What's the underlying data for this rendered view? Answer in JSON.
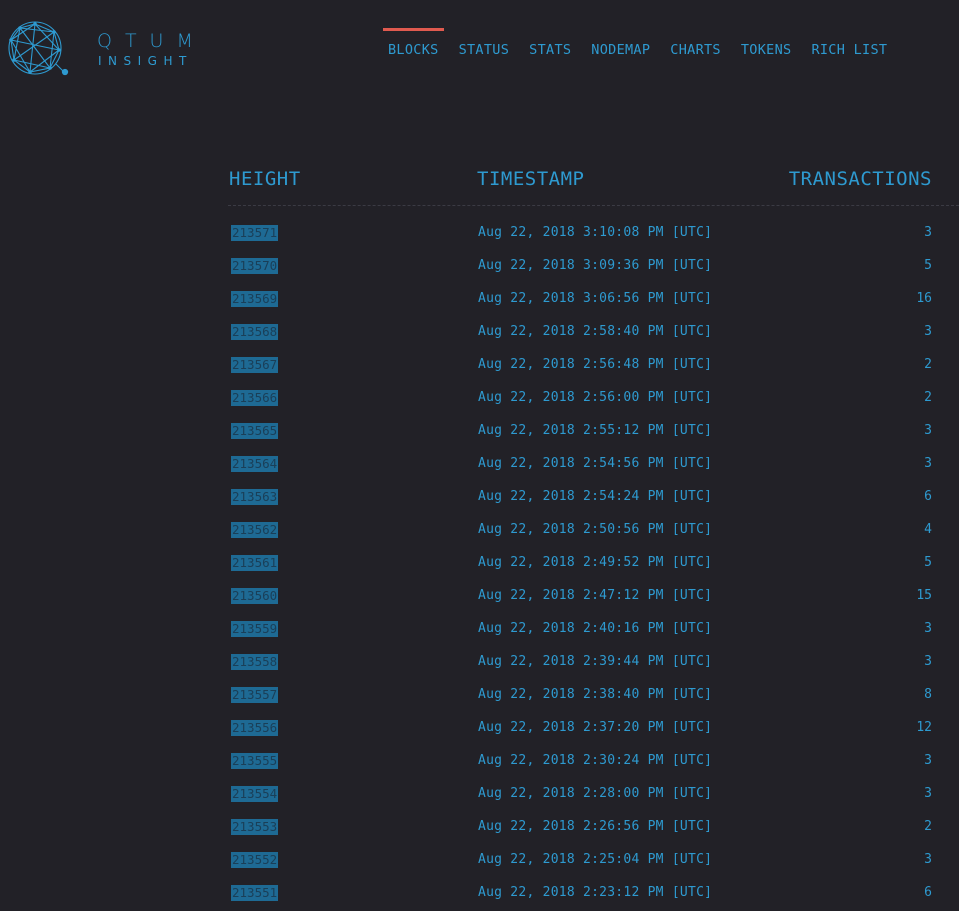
{
  "brand": {
    "name": "QTUM",
    "subtitle": "INSIGHT",
    "logo_icon": "qtum-network-icon",
    "accent_color": "#2e9ad0",
    "active_color": "#e05a4f"
  },
  "nav": {
    "items": [
      {
        "label": "BLOCKS",
        "active": true
      },
      {
        "label": "STATUS",
        "active": false
      },
      {
        "label": "STATS",
        "active": false
      },
      {
        "label": "NODEMAP",
        "active": false
      },
      {
        "label": "CHARTS",
        "active": false
      },
      {
        "label": "TOKENS",
        "active": false
      },
      {
        "label": "RICH LIST",
        "active": false
      }
    ]
  },
  "table": {
    "headers": {
      "height": "HEIGHT",
      "timestamp": "TIMESTAMP",
      "transactions": "TRANSACTIONS"
    },
    "rows": [
      {
        "height": "213571",
        "timestamp": "Aug 22, 2018 3:10:08 PM [UTC]",
        "transactions": "3"
      },
      {
        "height": "213570",
        "timestamp": "Aug 22, 2018 3:09:36 PM [UTC]",
        "transactions": "5"
      },
      {
        "height": "213569",
        "timestamp": "Aug 22, 2018 3:06:56 PM [UTC]",
        "transactions": "16"
      },
      {
        "height": "213568",
        "timestamp": "Aug 22, 2018 2:58:40 PM [UTC]",
        "transactions": "3"
      },
      {
        "height": "213567",
        "timestamp": "Aug 22, 2018 2:56:48 PM [UTC]",
        "transactions": "2"
      },
      {
        "height": "213566",
        "timestamp": "Aug 22, 2018 2:56:00 PM [UTC]",
        "transactions": "2"
      },
      {
        "height": "213565",
        "timestamp": "Aug 22, 2018 2:55:12 PM [UTC]",
        "transactions": "3"
      },
      {
        "height": "213564",
        "timestamp": "Aug 22, 2018 2:54:56 PM [UTC]",
        "transactions": "3"
      },
      {
        "height": "213563",
        "timestamp": "Aug 22, 2018 2:54:24 PM [UTC]",
        "transactions": "6"
      },
      {
        "height": "213562",
        "timestamp": "Aug 22, 2018 2:50:56 PM [UTC]",
        "transactions": "4"
      },
      {
        "height": "213561",
        "timestamp": "Aug 22, 2018 2:49:52 PM [UTC]",
        "transactions": "5"
      },
      {
        "height": "213560",
        "timestamp": "Aug 22, 2018 2:47:12 PM [UTC]",
        "transactions": "15"
      },
      {
        "height": "213559",
        "timestamp": "Aug 22, 2018 2:40:16 PM [UTC]",
        "transactions": "3"
      },
      {
        "height": "213558",
        "timestamp": "Aug 22, 2018 2:39:44 PM [UTC]",
        "transactions": "3"
      },
      {
        "height": "213557",
        "timestamp": "Aug 22, 2018 2:38:40 PM [UTC]",
        "transactions": "8"
      },
      {
        "height": "213556",
        "timestamp": "Aug 22, 2018 2:37:20 PM [UTC]",
        "transactions": "12"
      },
      {
        "height": "213555",
        "timestamp": "Aug 22, 2018 2:30:24 PM [UTC]",
        "transactions": "3"
      },
      {
        "height": "213554",
        "timestamp": "Aug 22, 2018 2:28:00 PM [UTC]",
        "transactions": "3"
      },
      {
        "height": "213553",
        "timestamp": "Aug 22, 2018 2:26:56 PM [UTC]",
        "transactions": "2"
      },
      {
        "height": "213552",
        "timestamp": "Aug 22, 2018 2:25:04 PM [UTC]",
        "transactions": "3"
      },
      {
        "height": "213551",
        "timestamp": "Aug 22, 2018 2:23:12 PM [UTC]",
        "transactions": "6"
      }
    ]
  }
}
